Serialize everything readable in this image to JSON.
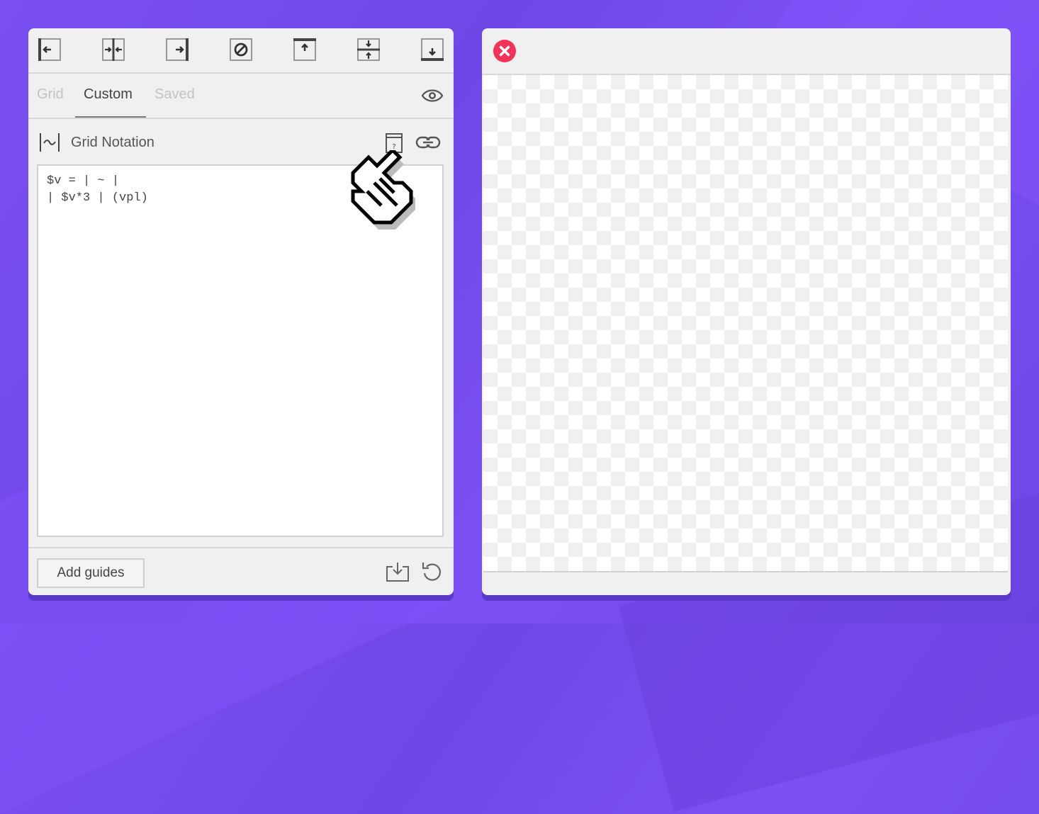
{
  "toolbar": {
    "icons": [
      "align-left-icon",
      "align-center-vertical-icon",
      "align-right-icon",
      "disable-icon",
      "align-top-icon",
      "align-middle-horizontal-icon",
      "align-bottom-icon"
    ]
  },
  "tabs": {
    "items": [
      {
        "label": "Grid",
        "active": false
      },
      {
        "label": "Custom",
        "active": true
      },
      {
        "label": "Saved",
        "active": false
      }
    ],
    "visibility_icon": "eye-icon"
  },
  "notation": {
    "title": "Grid Notation",
    "icon": "grid-notation-icon",
    "help_icon": "help-document-icon",
    "link_icon": "link-icon"
  },
  "editor": {
    "value": "$v = | ~ |\n| $v*3 | (vpl)"
  },
  "footer": {
    "add_button_label": "Add guides",
    "import_icon": "import-icon",
    "reset_icon": "reset-icon"
  },
  "window": {
    "close_icon": "close-icon",
    "close_color": "#f23358"
  },
  "colors": {
    "background": "#7a4ff2",
    "panel": "#f0f0f0",
    "border": "#d6d6d6"
  }
}
